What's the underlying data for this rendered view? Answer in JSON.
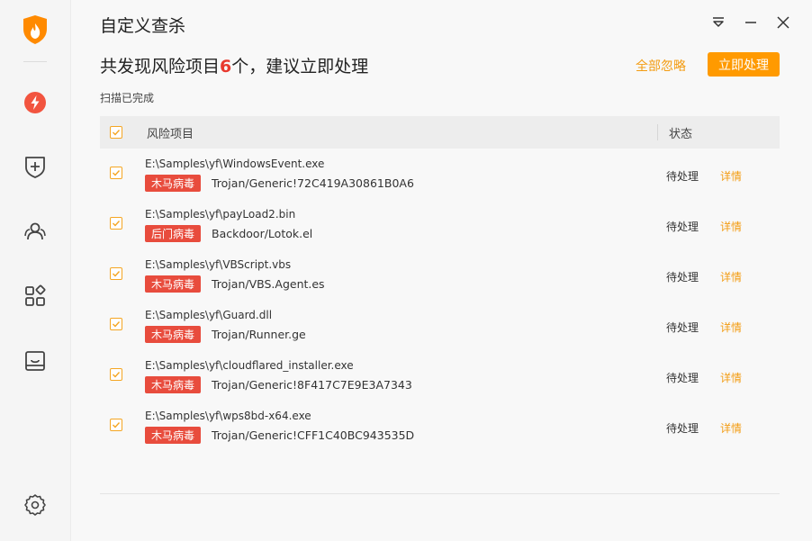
{
  "window": {
    "title": "自定义查杀"
  },
  "summary": {
    "prefix": "共发现风险项目",
    "count": "6",
    "suffix": "个，建议立即处理",
    "scan_status": "扫描已完成",
    "ignore_all_label": "全部忽略",
    "handle_now_label": "立即处理"
  },
  "table": {
    "headers": {
      "risk": "风险项目",
      "status": "状态"
    },
    "rows": [
      {
        "path": "E:\\Samples\\yf\\WindowsEvent.exe",
        "tag": "木马病毒",
        "virus": "Trojan/Generic!72C419A30861B0A6",
        "status": "待处理",
        "detail": "详情"
      },
      {
        "path": "E:\\Samples\\yf\\payLoad2.bin",
        "tag": "后门病毒",
        "virus": "Backdoor/Lotok.el",
        "status": "待处理",
        "detail": "详情"
      },
      {
        "path": "E:\\Samples\\yf\\VBScript.vbs",
        "tag": "木马病毒",
        "virus": "Trojan/VBS.Agent.es",
        "status": "待处理",
        "detail": "详情"
      },
      {
        "path": "E:\\Samples\\yf\\Guard.dll",
        "tag": "木马病毒",
        "virus": "Trojan/Runner.ge",
        "status": "待处理",
        "detail": "详情"
      },
      {
        "path": "E:\\Samples\\yf\\cloudflared_installer.exe",
        "tag": "木马病毒",
        "virus": "Trojan/Generic!8F417C7E9E3A7343",
        "status": "待处理",
        "detail": "详情"
      },
      {
        "path": "E:\\Samples\\yf\\wps8bd-x64.exe",
        "tag": "木马病毒",
        "virus": "Trojan/Generic!CFF1C40BC943535D",
        "status": "待处理",
        "detail": "详情"
      }
    ]
  },
  "colors": {
    "accent": "#ff9a00",
    "danger": "#e84c3d",
    "link": "#f39c12"
  }
}
